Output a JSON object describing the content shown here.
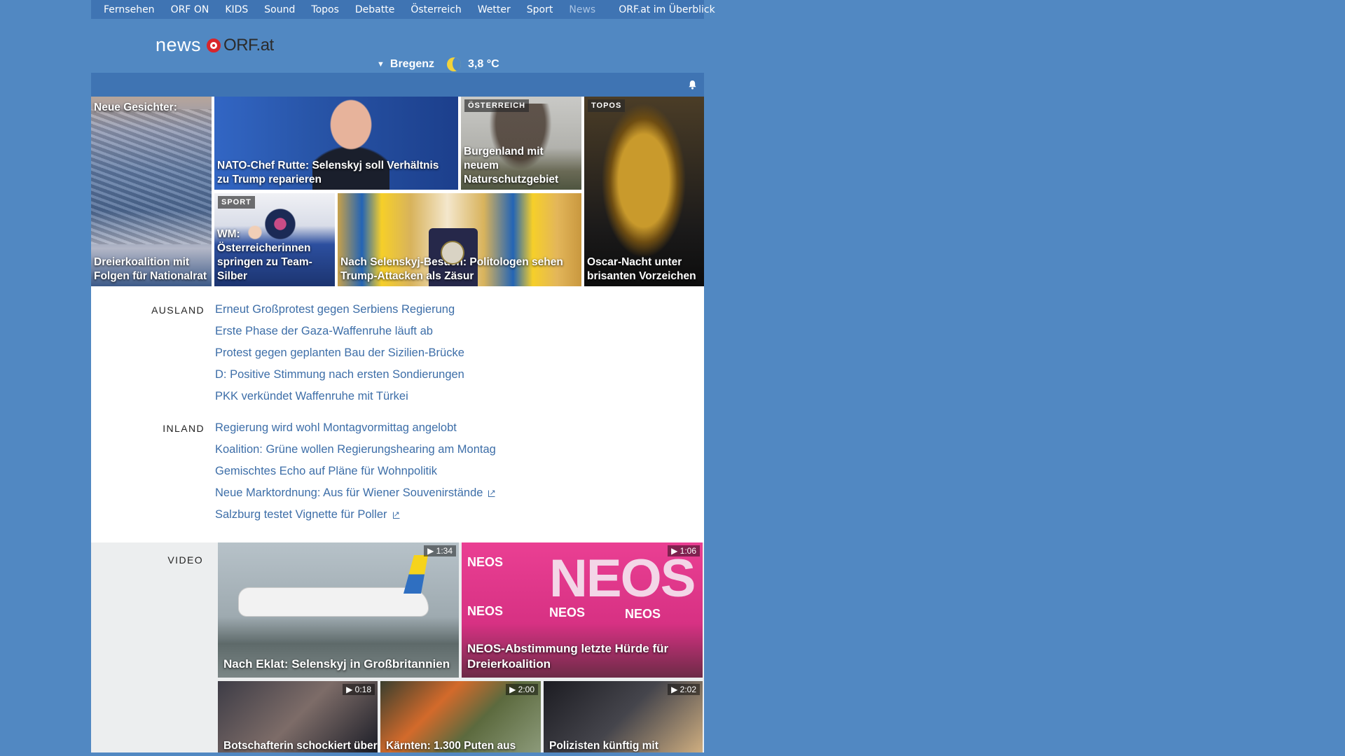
{
  "topnav": {
    "items": [
      "Fernsehen",
      "ORF ON",
      "KIDS",
      "Sound",
      "Topos",
      "Debatte",
      "Österreich",
      "Wetter",
      "Sport",
      "News"
    ],
    "active": "News",
    "overview": "ORF.at im Überblick"
  },
  "header": {
    "logo_news": "news",
    "logo_orf": "ORF.at",
    "weather": {
      "city": "Bregenz",
      "temp": "3,8 °C",
      "icon": "moon-icon"
    }
  },
  "teasers": [
    {
      "caption_top": "Neue Gesichter:",
      "caption": "Dreierkoalition mit Folgen für Nationalrat",
      "tag": ""
    },
    {
      "caption": "NATO-Chef Rutte: Selenskyj soll Verhältnis zu Trump reparieren",
      "tag": ""
    },
    {
      "caption": "Burgenland mit neuem Naturschutzgebiet",
      "tag": "ÖSTERREICH"
    },
    {
      "caption": "Oscar-Nacht unter brisanten Vorzeichen",
      "tag": "TOPOS"
    },
    {
      "caption": "WM: Österreicherinnen springen zu Team-Silber",
      "tag": "SPORT"
    },
    {
      "caption": "Nach Selenskyj-Besuch: Politologen sehen Trump-Attacken als Zäsur",
      "tag": ""
    }
  ],
  "ausland": {
    "label": "AUSLAND",
    "items": [
      "Erneut Großprotest gegen Serbiens Regierung",
      "Erste Phase der Gaza-Waffenruhe läuft ab",
      "Protest gegen geplanten Bau der Sizilien-Brücke",
      "D: Positive Stimmung nach ersten Sondierungen",
      "PKK verkündet Waffenruhe mit Türkei"
    ]
  },
  "inland": {
    "label": "INLAND",
    "items": [
      "Regierung wird wohl Montagvormittag angelobt",
      "Koalition: Grüne wollen Regierungshearing am Montag",
      "Gemischtes Echo auf Pläne für Wohnpolitik",
      "Neue Marktordnung: Aus für Wiener Souvenirstände",
      "Salzburg testet Vignette für Poller"
    ]
  },
  "video": {
    "label": "VIDEO",
    "items": [
      {
        "caption": "Nach Eklat: Selenskyj in Großbritannien",
        "duration": "1:34"
      },
      {
        "caption": "NEOS-Abstimmung letzte Hürde für Dreierkoalition",
        "duration": "1:06",
        "brand": "NEOS"
      },
      {
        "caption": "Botschafterin schockiert über",
        "duration": "0:18"
      },
      {
        "caption": "Kärnten: 1.300 Puten aus",
        "duration": "2:00"
      },
      {
        "caption": "Polizisten künftig mit",
        "duration": "2:02"
      }
    ]
  }
}
